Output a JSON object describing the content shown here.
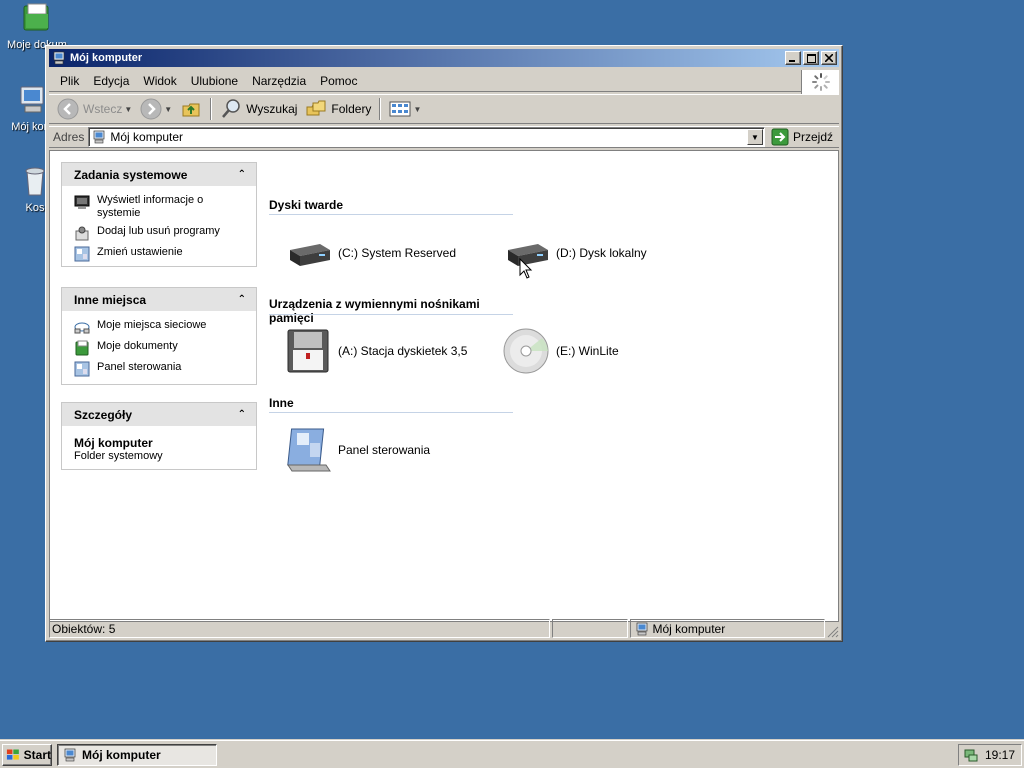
{
  "desktop": {
    "icons": [
      {
        "label": "Moje dokum",
        "icon": "my-documents-icon"
      },
      {
        "label": "Mój kom",
        "icon": "my-computer-icon"
      },
      {
        "label": "Kos",
        "icon": "recycle-bin-icon"
      }
    ]
  },
  "window": {
    "title": "Mój komputer",
    "menu": [
      "Plik",
      "Edycja",
      "Widok",
      "Ulubione",
      "Narzędzia",
      "Pomoc"
    ],
    "toolbar": {
      "back": "Wstecz",
      "search": "Wyszukaj",
      "folders": "Foldery"
    },
    "address": {
      "label": "Adres",
      "value": "Mój komputer",
      "go": "Przejdź"
    },
    "tasks_panel": {
      "title": "Zadania systemowe",
      "items": [
        {
          "label": "Wyświetl informacje o systemie",
          "icon": "system-info-icon"
        },
        {
          "label": "Dodaj lub usuń programy",
          "icon": "add-remove-programs-icon"
        },
        {
          "label": "Zmień ustawienie",
          "icon": "control-panel-icon"
        }
      ]
    },
    "places_panel": {
      "title": "Inne miejsca",
      "items": [
        {
          "label": "Moje miejsca sieciowe",
          "icon": "network-places-icon"
        },
        {
          "label": "Moje dokumenty",
          "icon": "my-documents-icon"
        },
        {
          "label": "Panel sterowania",
          "icon": "control-panel-icon"
        }
      ]
    },
    "details_panel": {
      "title": "Szczegóły",
      "name": "Mój komputer",
      "type": "Folder systemowy"
    },
    "groups": [
      {
        "title": "Dyski twarde",
        "items": [
          {
            "label": "(C:) System Reserved",
            "icon": "hard-drive-icon"
          },
          {
            "label": "(D:) Dysk lokalny",
            "icon": "hard-drive-icon"
          }
        ]
      },
      {
        "title": "Urządzenia z wymiennymi nośnikami pamięci",
        "items": [
          {
            "label": "(A:) Stacja dyskietek 3,5",
            "icon": "floppy-drive-icon"
          },
          {
            "label": "(E:) WinLite",
            "icon": "cd-drive-icon"
          }
        ]
      },
      {
        "title": "Inne",
        "items": [
          {
            "label": "Panel sterowania",
            "icon": "control-panel-icon"
          }
        ]
      }
    ],
    "status": {
      "count": "Obiektów: 5",
      "location": "Mój komputer"
    }
  },
  "taskbar": {
    "start": "Start",
    "task": "Mój komputer",
    "clock": "19:17"
  },
  "colors": {
    "desktop": "#3a6ea5",
    "title_start": "#0a246a",
    "title_end": "#a6caf0",
    "chrome": "#d4d0c8"
  }
}
